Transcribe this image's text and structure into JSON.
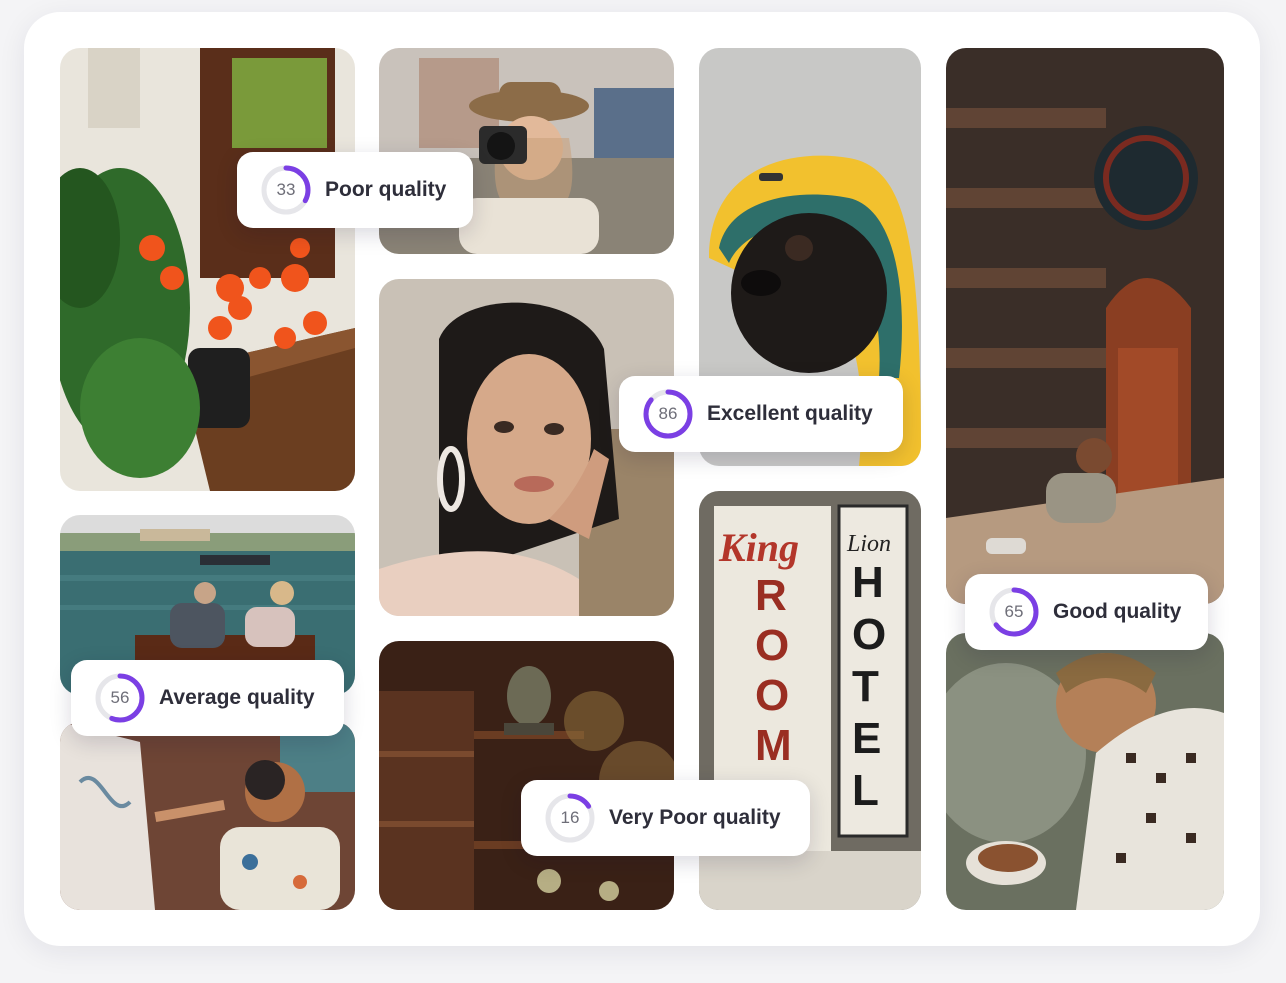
{
  "accent_color": "#7b3fe4",
  "track_color": "#e6e6ea",
  "photos": [
    {
      "id": "flowers",
      "subject": "orange gladiolus flowers in a black vase on a wooden table"
    },
    {
      "id": "sea",
      "subject": "elderly couple on a bench by the sea"
    },
    {
      "id": "painter",
      "subject": "man with headphones painting a canvas"
    },
    {
      "id": "photographer",
      "subject": "woman in a hat holding a camera"
    },
    {
      "id": "woman",
      "subject": "portrait of a woman with earrings"
    },
    {
      "id": "shelf",
      "subject": "dark wooden shelf with a monkey statue"
    },
    {
      "id": "dog",
      "subject": "black pug in a yellow raincoat hood"
    },
    {
      "id": "hotel",
      "subject": "painted sign wall"
    },
    {
      "id": "arch",
      "subject": "person crouching by an ornate archway"
    },
    {
      "id": "cook",
      "subject": "man in a knit sweater holding food"
    }
  ],
  "badges": {
    "poor": {
      "score": "33",
      "value": 33,
      "label": "Poor quality"
    },
    "excellent": {
      "score": "86",
      "value": 86,
      "label": "Excellent quality"
    },
    "good": {
      "score": "65",
      "value": 65,
      "label": "Good quality"
    },
    "average": {
      "score": "56",
      "value": 56,
      "label": "Average quality"
    },
    "very_poor": {
      "score": "16",
      "value": 16,
      "label": "Very Poor quality"
    }
  },
  "sign_text": {
    "king": "King",
    "lion": "Lion",
    "room": "ROOM",
    "hotel": "HOTEL"
  }
}
